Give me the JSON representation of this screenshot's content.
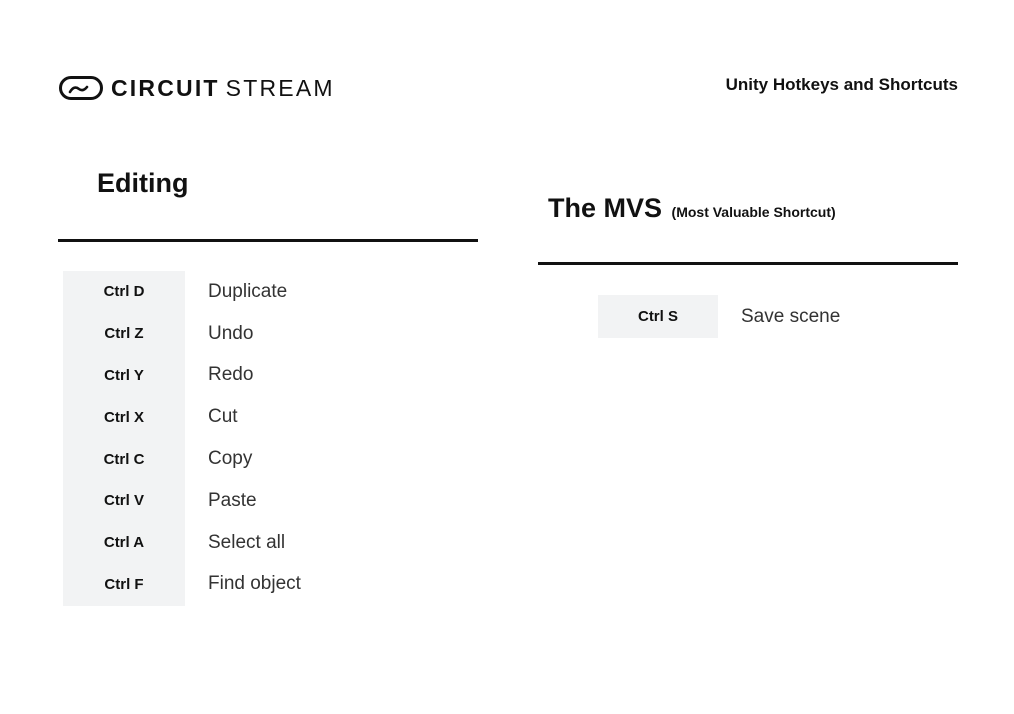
{
  "header": {
    "brand_primary": "CIRCUIT",
    "brand_secondary": "STREAM",
    "logo_icon": "circuit-stream-logo-icon",
    "doc_title": "Unity Hotkeys and Shortcuts"
  },
  "editing": {
    "heading": "Editing",
    "shortcuts": [
      {
        "key": "Ctrl D",
        "action": "Duplicate"
      },
      {
        "key": "Ctrl Z",
        "action": "Undo"
      },
      {
        "key": "Ctrl Y",
        "action": "Redo"
      },
      {
        "key": "Ctrl X",
        "action": "Cut"
      },
      {
        "key": "Ctrl C",
        "action": "Copy"
      },
      {
        "key": "Ctrl V",
        "action": "Paste"
      },
      {
        "key": "Ctrl A",
        "action": "Select all"
      },
      {
        "key": "Ctrl F",
        "action": "Find object"
      }
    ]
  },
  "mvs": {
    "heading": "The MVS",
    "subheading": "(Most Valuable Shortcut)",
    "shortcut": {
      "key": "Ctrl S",
      "action": "Save scene"
    }
  },
  "colors": {
    "text": "#111111",
    "key_background": "#f2f3f4",
    "action_text": "#333333"
  }
}
